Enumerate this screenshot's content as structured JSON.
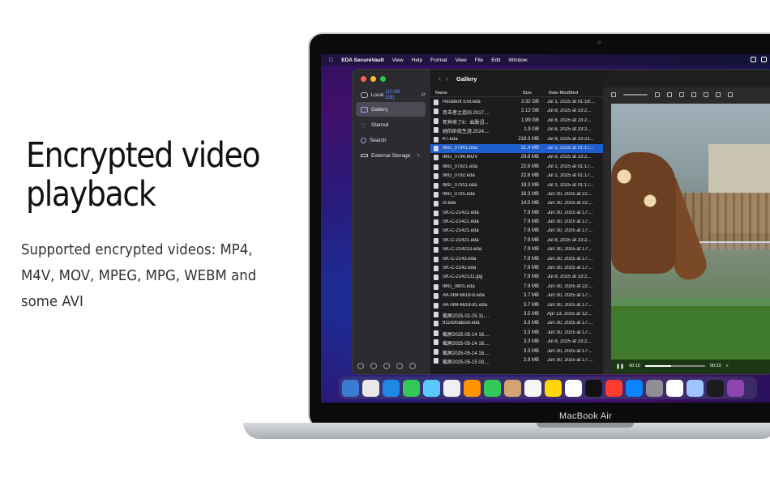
{
  "promo": {
    "headline": "Encrypted video playback",
    "subtext": "Supported encrypted videos: MP4, M4V, MOV, MPEG, MPG, WEBM and some AVI"
  },
  "device_label": "MacBook Air",
  "menubar": {
    "app_name": "EDA SecureVault",
    "items": [
      "View",
      "Help",
      "Format",
      "View",
      "File",
      "Edit",
      "Window"
    ]
  },
  "sidebar": {
    "local_label": "Local",
    "local_size": "(10.69 GB)",
    "items": [
      {
        "label": "Gallery",
        "icon": "gallery-icon"
      },
      {
        "label": "Starred",
        "icon": "heart-icon"
      },
      {
        "label": "Search",
        "icon": "search-icon"
      },
      {
        "label": "External Storage",
        "icon": "external-storage-icon"
      }
    ]
  },
  "titlebar": {
    "title": "Gallery"
  },
  "file_list": {
    "columns": [
      "Name",
      "Size",
      "Date Modified"
    ],
    "selected_index": 5,
    "rows": [
      {
        "name": "Resident Evil.eda",
        "size": "3.32 GB",
        "date": "Jul 1, 2025 at 01:18:..."
      },
      {
        "name": "目击者之追凶.2017....",
        "size": "2.12 GB",
        "date": "Jul 8, 2025 at 23:2..."
      },
      {
        "name": "死神来了6：血脉诅...",
        "size": "1.99 GB",
        "date": "Jul 8, 2025 at 23:2..."
      },
      {
        "name": "她的卧底生涯.2024....",
        "size": "1.9 GB",
        "date": "Jul 8, 2025 at 23:2..."
      },
      {
        "name": "KT.eda",
        "size": "218.3 MB",
        "date": "Jul 8, 2025 at 23:21..."
      },
      {
        "name": "IMG_07941.eda",
        "size": "31.4 MB",
        "date": "Jul 1, 2025 at 01:17..."
      },
      {
        "name": "IMG_0794.MOV",
        "size": "29.8 MB",
        "date": "Jul 8, 2025 at 23:2..."
      },
      {
        "name": "IMG_07921.eda",
        "size": "22.6 MB",
        "date": "Jul 1, 2025 at 01:17..."
      },
      {
        "name": "IMG_0792.eda",
        "size": "22.6 MB",
        "date": "Jul 1, 2025 at 01:17..."
      },
      {
        "name": "IMG_07911.eda",
        "size": "18.3 MB",
        "date": "Jul 1, 2025 at 01:17..."
      },
      {
        "name": "IMG_0791.eda",
        "size": "18.3 MB",
        "date": "Jun 30, 2025 at 22:..."
      },
      {
        "name": "cf.eda",
        "size": "14.5 MB",
        "date": "Jun 30, 2025 at 22:..."
      },
      {
        "name": "SK-C-21422.eda",
        "size": "7.9 MB",
        "date": "Jun 30, 2025 at 17:..."
      },
      {
        "name": "SK-C-21421.eda",
        "size": "7.9 MB",
        "date": "Jun 30, 2025 at 17:..."
      },
      {
        "name": "SK-C-21421.eda",
        "size": "7.9 MB",
        "date": "Jun 30, 2025 at 17:..."
      },
      {
        "name": "SK-C-21421.eda",
        "size": "7.9 MB",
        "date": "Jul 8, 2025 at 23:2..."
      },
      {
        "name": "SK-C-214213.eda",
        "size": "7.9 MB",
        "date": "Jun 30, 2025 at 17:..."
      },
      {
        "name": "SK-C-2143.eda",
        "size": "7.9 MB",
        "date": "Jun 30, 2025 at 17:..."
      },
      {
        "name": "SK-C-2142.eda",
        "size": "7.9 MB",
        "date": "Jun 30, 2025 at 17:..."
      },
      {
        "name": "SK-C-2142131.jpg",
        "size": "7.9 MB",
        "date": "Jul 8, 2025 at 23:2..."
      },
      {
        "name": "IMG_0801.eda",
        "size": "7.9 MB",
        "date": "Jun 30, 2025 at 22:..."
      },
      {
        "name": "AK-NM-6618-8.eda",
        "size": "3.7 MB",
        "date": "Jun 30, 2025 at 17:..."
      },
      {
        "name": "AK-NM-6618-81.eda",
        "size": "3.7 MB",
        "date": "Jun 30, 2025 at 17:..."
      },
      {
        "name": "截屏2025-02-25 11....",
        "size": "3.5 MB",
        "date": "Apr 13, 2025 at 12:..."
      },
      {
        "name": "911630absdl.eda",
        "size": "3.3 MB",
        "date": "Jun 30, 2025 at 17:..."
      },
      {
        "name": "截屏2025-05-14 16....",
        "size": "3.3 MB",
        "date": "Jun 30, 2025 at 17:..."
      },
      {
        "name": "截屏2025-05-14 16....",
        "size": "3.3 MB",
        "date": "Jul 8, 2025 at 23:2..."
      },
      {
        "name": "截屏2025-05-14 16....",
        "size": "3.3 MB",
        "date": "Jun 30, 2025 at 17:..."
      },
      {
        "name": "截屏2025-05-15 00....",
        "size": "2.9 MB",
        "date": "Jun 30, 2025 at 17:..."
      }
    ]
  },
  "player": {
    "current_time": "00:10",
    "duration": "00:23",
    "progress_fraction": 0.43,
    "play_icon": "pause-icon"
  },
  "colors": {
    "selection": "#1f5ecf",
    "sidebar_size": "#6f8fff"
  }
}
